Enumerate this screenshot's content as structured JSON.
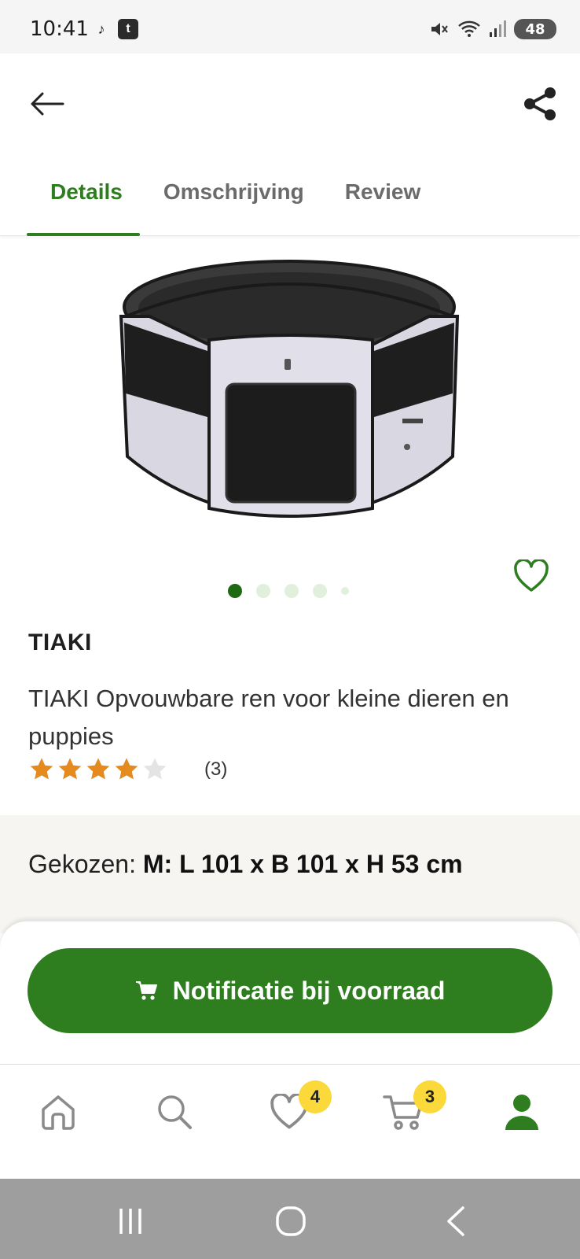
{
  "status_bar": {
    "time": "10:41",
    "apps": [
      "tiktok-icon",
      "t-app-icon"
    ],
    "battery": "48"
  },
  "header": {
    "back_icon": "arrow-left-icon",
    "share_icon": "share-icon",
    "tabs": [
      {
        "label": "Details",
        "active": true
      },
      {
        "label": "Omschrijving",
        "active": false
      },
      {
        "label": "Review",
        "active": false
      }
    ]
  },
  "carousel": {
    "total": 5,
    "active_index": 0
  },
  "product": {
    "brand": "TIAKI",
    "title": "TIAKI Opvouwbare ren voor kleine dieren en puppies",
    "rating": 4,
    "rating_max": 5,
    "rating_count": "(3)",
    "favorite_icon": "heart-outline-icon"
  },
  "variant": {
    "prefix": "Gekozen: ",
    "value": "M: L 101 x B 101 x H 53 cm"
  },
  "cta": {
    "label": "Notificatie bij voorraad",
    "icon": "cart-icon"
  },
  "bottom_nav": {
    "items": [
      {
        "name": "home",
        "icon": "home-icon"
      },
      {
        "name": "search",
        "icon": "search-icon"
      },
      {
        "name": "favorites",
        "icon": "heart-icon",
        "badge": "4"
      },
      {
        "name": "cart",
        "icon": "cart-icon",
        "badge": "3"
      },
      {
        "name": "account",
        "icon": "user-icon"
      }
    ]
  },
  "colors": {
    "primary_green": "#2e7d1f",
    "star_orange": "#e58a1f",
    "badge_yellow": "#fbd93b",
    "section_bg": "#f6f5f2"
  }
}
